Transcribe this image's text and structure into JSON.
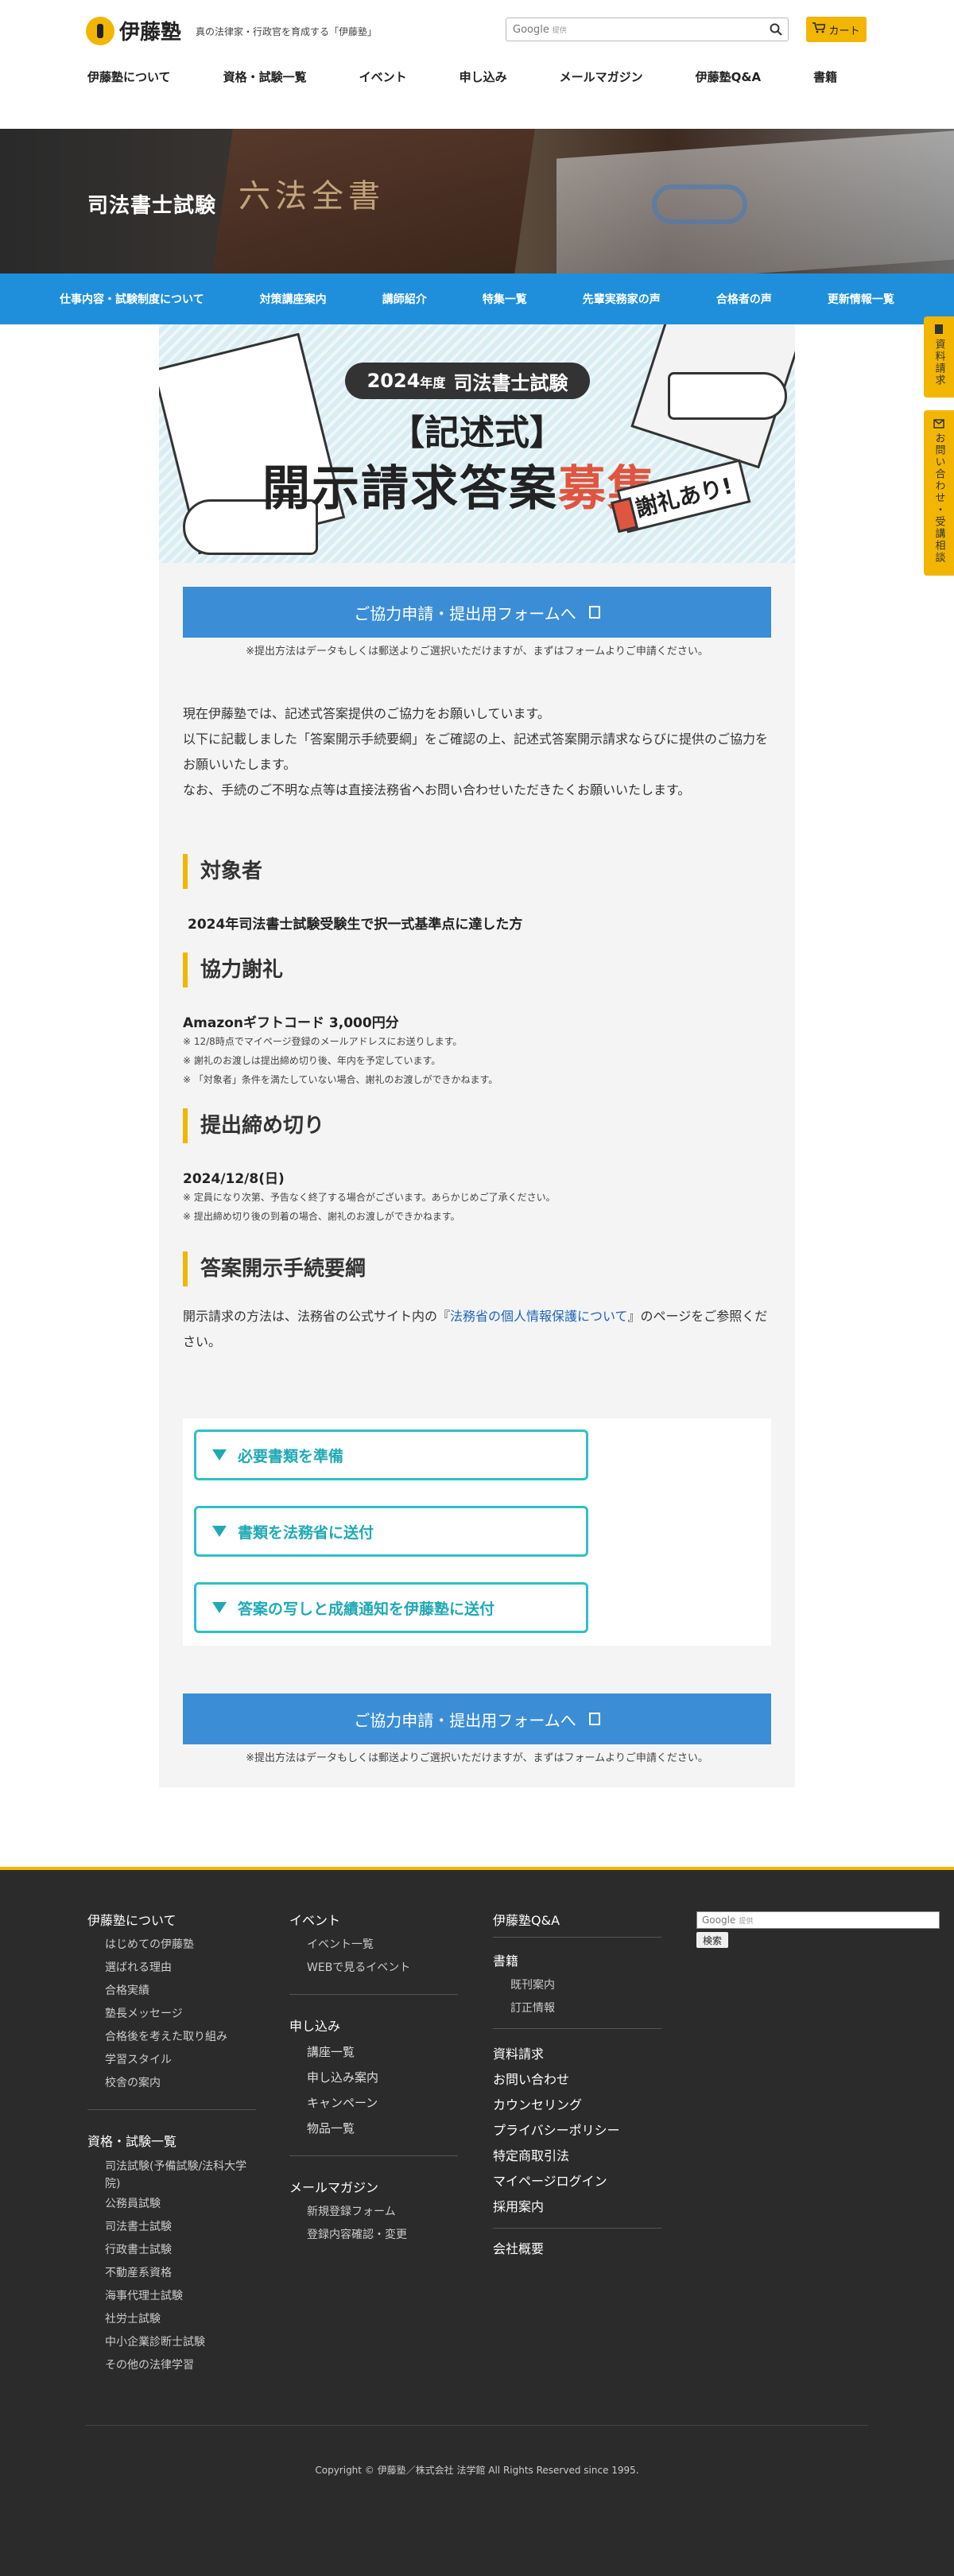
{
  "header": {
    "logo_text": "伊藤塾",
    "tagline": "真の法律家・行政官を育成する「伊藤塾」",
    "search_label": "Google",
    "search_sub": "提供",
    "cart_label": "カート",
    "nav": [
      "伊藤塾について",
      "資格・試験一覧",
      "イベント",
      "申し込み",
      "メールマガジン",
      "伊藤塾Q&A",
      "書籍"
    ]
  },
  "hero": {
    "title": "司法書士試験",
    "book_text": "六法全書"
  },
  "subnav": [
    "仕事内容・試験制度について",
    "対策講座案内",
    "講師紹介",
    "特集一覧",
    "先輩実務家の声",
    "合格者の声",
    "更新情報一覧"
  ],
  "sidetabs": {
    "docs": "資料請求",
    "contact": "お問い合わせ・受講相談"
  },
  "banner": {
    "year": "2024",
    "year_suffix": "年度",
    "exam": "司法書士試験",
    "line2": "【記述式】",
    "line3_main": "開示請求答案",
    "line3_accent": "募集",
    "tag": "謝礼あり!"
  },
  "cta": {
    "label": "ご協力申請・提出用フォームへ",
    "note": "※提出方法はデータもしくは郵送よりご選択いただけますが、まずはフォームよりご申請ください。"
  },
  "intro": [
    "現在伊藤塾では、記述式答案提供のご協力をお願いしています。",
    "以下に記載しました「答案開示手続要綱」をご確認の上、記述式答案開示請求ならびに提供のご協力をお願いいたします。",
    "なお、手続のご不明な点等は直接法務省へお問い合わせいただきたくお願いいたします。"
  ],
  "sections": {
    "target": {
      "heading": "対象者",
      "text": "2024年司法書士試験受験生で択一式基準点に達した方"
    },
    "reward": {
      "heading": "協力謝礼",
      "text": "Amazonギフトコード 3,000円分",
      "notes": [
        "※ 12/8時点でマイページ登録のメールアドレスにお送りします。",
        "※ 謝礼のお渡しは提出締め切り後、年内を予定しています。",
        "※ 「対象者」条件を満たしていない場合、謝礼のお渡しができかねます。"
      ]
    },
    "deadline": {
      "heading": "提出締め切り",
      "text": "2024/12/8(日)",
      "notes": [
        "※ 定員になり次第、予告なく終了する場合がございます。あらかじめご了承ください。",
        "※ 提出締め切り後の到着の場合、謝礼のお渡しができかねます。"
      ]
    },
    "procedure": {
      "heading": "答案開示手続要綱",
      "text_before": "開示請求の方法は、法務省の公式サイト内の『",
      "link": "法務省の個人情報保護について",
      "text_after": "』のページをご参照ください。"
    }
  },
  "accordion": [
    "必要書類を準備",
    "書類を法務省に送付",
    "答案の写しと成績通知を伊藤塾に送付"
  ],
  "footer": {
    "col1": {
      "about": "伊藤塾について",
      "about_items": [
        "はじめての伊藤塾",
        "選ばれる理由",
        "合格実績",
        "塾長メッセージ",
        "合格後を考えた取り組み",
        "学習スタイル",
        "校舎の案内"
      ],
      "exams": "資格・試験一覧",
      "exam_items": [
        "司法試験(予備試験/法科大学",
        "院)",
        "公務員試験",
        "司法書士試験",
        "行政書士試験",
        "不動産系資格",
        "海事代理士試験",
        "社労士試験",
        "中小企業診断士試験",
        "その他の法律学習"
      ]
    },
    "col2": {
      "event": "イベント",
      "event_items": [
        "イベント一覧",
        "WEBで見るイベント"
      ],
      "apply": "申し込み",
      "apply_items": [
        "講座一覧",
        "申し込み案内",
        "キャンペーン",
        "物品一覧"
      ],
      "mail": "メールマガジン",
      "mail_items": [
        "新規登録フォーム",
        "登録内容確認・変更"
      ]
    },
    "col3": {
      "qa": "伊藤塾Q&A",
      "books": "書籍",
      "books_items": [
        "既刊案内",
        "訂正情報"
      ],
      "links": [
        "資料請求",
        "お問い合わせ",
        "カウンセリング",
        "プライバシーポリシー",
        "特定商取引法",
        "マイページログイン",
        "採用案内"
      ],
      "company": "会社概要"
    },
    "search": {
      "label": "Google",
      "sub": "提供",
      "button": "検索"
    },
    "copyright": "Copyright © 伊藤塾／株式会社 法学館 All Rights Reserved since 1995."
  }
}
